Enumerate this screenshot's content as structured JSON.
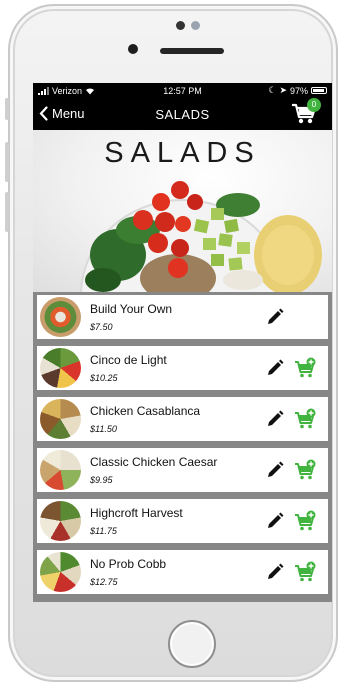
{
  "status": {
    "carrier": "Verizon",
    "time": "12:57 PM",
    "battery": "97%"
  },
  "nav": {
    "back_label": "Menu",
    "title": "SALADS",
    "cart_count": "0"
  },
  "hero": {
    "title": "SALADS"
  },
  "items": [
    {
      "name": "Build Your Own",
      "price": "$7.50",
      "has_cart": false
    },
    {
      "name": "Cinco de Light",
      "price": "$10.25",
      "has_cart": true
    },
    {
      "name": "Chicken Casablanca",
      "price": "$11.50",
      "has_cart": true
    },
    {
      "name": "Classic Chicken Caesar",
      "price": "$9.95",
      "has_cart": true
    },
    {
      "name": "Highcroft Harvest",
      "price": "$11.75",
      "has_cart": true
    },
    {
      "name": "No Prob Cobb",
      "price": "$12.75",
      "has_cart": true
    }
  ],
  "icons": {
    "edit": "pencil-icon",
    "add_to_cart": "cart-plus-icon",
    "cart": "shopping-cart-icon",
    "back": "chevron-left-icon"
  },
  "colors": {
    "accent_green": "#41b43f",
    "nav_background": "#000000",
    "list_background": "#878787"
  }
}
